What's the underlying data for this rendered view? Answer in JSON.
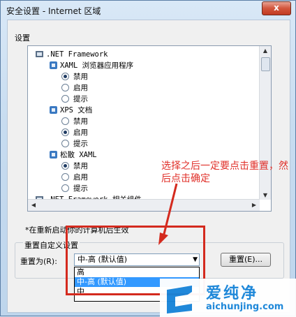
{
  "window": {
    "title": "安全设置 - Internet 区域",
    "close_label": "x"
  },
  "settings": {
    "label": "设置"
  },
  "tree": [
    {
      "text": ".NET Framework",
      "indent": 0,
      "kind": "group"
    },
    {
      "text": "XAML 浏览器应用程序",
      "indent": 1,
      "kind": "sub"
    },
    {
      "text": "禁用",
      "indent": 2,
      "kind": "radio",
      "checked": true
    },
    {
      "text": "启用",
      "indent": 2,
      "kind": "radio",
      "checked": false
    },
    {
      "text": "提示",
      "indent": 2,
      "kind": "radio",
      "checked": false
    },
    {
      "text": "XPS 文档",
      "indent": 1,
      "kind": "sub"
    },
    {
      "text": "禁用",
      "indent": 2,
      "kind": "radio",
      "checked": false
    },
    {
      "text": "启用",
      "indent": 2,
      "kind": "radio",
      "checked": true
    },
    {
      "text": "提示",
      "indent": 2,
      "kind": "radio",
      "checked": false
    },
    {
      "text": "松散 XAML",
      "indent": 1,
      "kind": "sub"
    },
    {
      "text": "禁用",
      "indent": 2,
      "kind": "radio",
      "checked": true
    },
    {
      "text": "启用",
      "indent": 2,
      "kind": "radio",
      "checked": false
    },
    {
      "text": "提示",
      "indent": 2,
      "kind": "radio",
      "checked": false
    },
    {
      "text": ".NET Framework 相关组件",
      "indent": 0,
      "kind": "group"
    }
  ],
  "footnote": "*在重新启动你的计算机后生效",
  "reset_group": {
    "title": "重置自定义设置",
    "label": "重置为(R):",
    "selected": "中-高 (默认值)",
    "options": [
      "高",
      "中-高 (默认值)",
      "中"
    ],
    "selected_index": 1,
    "button": "重置(E)..."
  },
  "annotation": "选择之后一定要点击重置，然后点击确定",
  "watermark": {
    "name": "爱纯净",
    "url": "aichunjing.com"
  },
  "colors": {
    "accent": "#3399ff",
    "annotation": "#e0302a",
    "watermark": "#1784d9"
  }
}
